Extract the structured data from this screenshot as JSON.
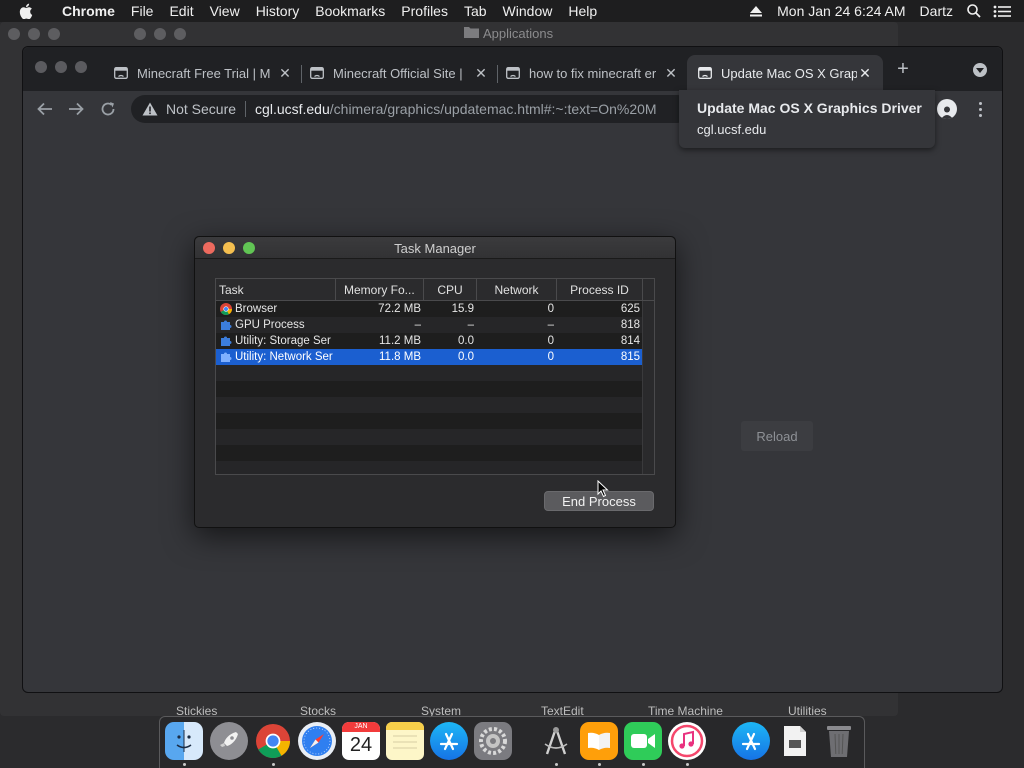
{
  "menubar": {
    "app_name": "Chrome",
    "menus": [
      "File",
      "Edit",
      "View",
      "History",
      "Bookmarks",
      "Profiles",
      "Tab",
      "Window",
      "Help"
    ],
    "clock": "Mon Jan 24  6:24 AM",
    "user": "Dartz"
  },
  "finder": {
    "title": "Applications",
    "bottom_labels": [
      "Stickies",
      "Stocks",
      "System",
      "TextEdit",
      "Time Machine",
      "Utilities"
    ]
  },
  "chrome": {
    "tabs": [
      {
        "title": "Minecraft Free Trial | M"
      },
      {
        "title": "Minecraft Official Site |"
      },
      {
        "title": "how to fix minecraft er"
      },
      {
        "title": "Update Mac OS X Grap"
      }
    ],
    "omnibox": {
      "security": "Not Secure",
      "host": "cgl.ucsf.edu",
      "path": "/chimera/graphics/updatemac.html#:~:text=On%20M"
    },
    "hovercard": {
      "title": "Update Mac OS X Graphics Driver",
      "domain": "cgl.ucsf.edu"
    },
    "reload_label": "Reload"
  },
  "task_manager": {
    "title": "Task Manager",
    "columns": [
      "Task",
      "Memory Fo...",
      "CPU",
      "Network",
      "Process ID"
    ],
    "rows": [
      {
        "task": "Browser",
        "memory": "72.2 MB",
        "cpu": "15.9",
        "network": "0",
        "pid": "625",
        "icon": "chrome-icon"
      },
      {
        "task": "GPU Process",
        "memory": "–",
        "cpu": "–",
        "network": "–",
        "pid": "818",
        "icon": "puzzle-icon"
      },
      {
        "task": "Utility: Storage Ser",
        "memory": "11.2 MB",
        "cpu": "0.0",
        "network": "0",
        "pid": "814",
        "icon": "puzzle-icon"
      },
      {
        "task": "Utility: Network Ser",
        "memory": "11.8 MB",
        "cpu": "0.0",
        "network": "0",
        "pid": "815",
        "icon": "puzzle-icon"
      }
    ],
    "selected_row": 3,
    "end_process_label": "End Process"
  },
  "dock": {
    "apps": [
      "finder-icon",
      "launchpad-icon",
      "chrome-icon",
      "safari-icon",
      "calendar-icon",
      "notes-icon",
      "app-store-icon",
      "system-preferences-icon",
      "instruments-icon",
      "books-icon",
      "facetime-icon",
      "itunes-icon",
      "app-store-downloads-icon",
      "document-icon",
      "trash-icon"
    ],
    "calendar": {
      "month": "JAN",
      "day": "24"
    }
  }
}
